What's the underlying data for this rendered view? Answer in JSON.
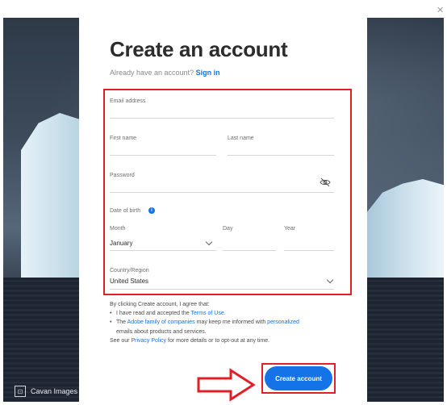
{
  "background": {
    "credit_label": "Cavan Images"
  },
  "header": {
    "title": "Create an account",
    "subtitle_prefix": "Already have an account?",
    "signin_link": "Sign in"
  },
  "form": {
    "email": {
      "label": "Email address",
      "value": ""
    },
    "first_name": {
      "label": "First name",
      "value": ""
    },
    "last_name": {
      "label": "Last name",
      "value": ""
    },
    "password": {
      "label": "Password",
      "value": "",
      "icon": "eye-off-icon"
    },
    "dob": {
      "label": "Date of birth",
      "info_icon": "info-icon",
      "month_label": "Month",
      "month_value": "January",
      "day_label": "Day",
      "year_label": "Year"
    },
    "country": {
      "label": "Country/Region",
      "value": "United States"
    }
  },
  "legal": {
    "intro": "By clicking Create account, I agree that:",
    "bullet1_prefix": "I have read and accepted the",
    "bullet1_link": "Terms of Use",
    "bullet1_suffix": ".",
    "bullet2_link1": "Adobe family of companies",
    "bullet2_middle": "may keep me informed with",
    "bullet2_link2": "personalized",
    "bullet2_suffix": "emails about products and services.",
    "footer_prefix": "See our",
    "footer_link": "Privacy Policy",
    "footer_suffix": "for more details or to opt-out at any time."
  },
  "actions": {
    "create_label": "Create account"
  },
  "colors": {
    "accent": "#1473e6",
    "highlight": "#e01f26"
  }
}
